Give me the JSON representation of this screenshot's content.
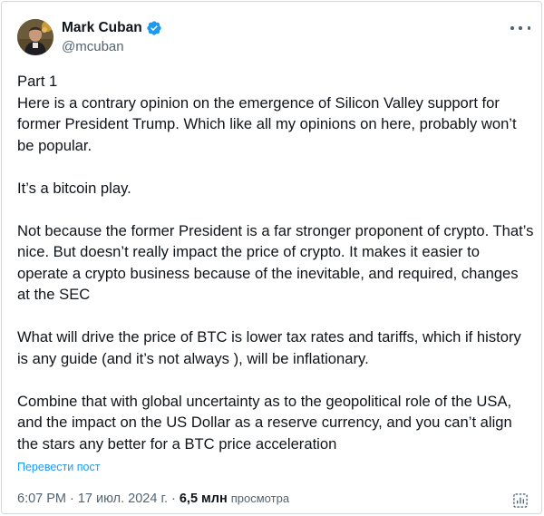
{
  "author": {
    "name": "Mark Cuban",
    "handle": "@mcuban",
    "avatar_icon": "portrait-photo",
    "verified_icon": "verified-badge-icon",
    "verified_color": "#1d9bf0"
  },
  "tweet": {
    "paragraphs": [
      "Part 1",
      "Here is a contrary opinion on the emergence of Silicon Valley support for former President Trump. Which like all my opinions on here, probably won’t be popular.",
      "It’s a bitcoin play.",
      "Not because the former President is a far stronger proponent of crypto. That’s nice. But doesn’t really impact the price of crypto. It makes it easier to operate a crypto business because of the inevitable, and required, changes at the SEC",
      "What will drive the price of BTC is lower tax rates and tariffs, which if history is any guide (and it’s not always ), will be inflationary.",
      "Combine that with global uncertainty as to the geopolitical role of the USA, and the impact on the US Dollar as a reserve currency, and you can’t align the stars any better for a BTC price acceleration"
    ],
    "translate_label": "Перевести пост"
  },
  "meta": {
    "time": "6:07 PM",
    "separator": "·",
    "date": "17 июл. 2024 г.",
    "views_count": "6,5 млн",
    "views_label": "просмотра"
  },
  "colors": {
    "text": "#0f1419",
    "secondary": "#536471",
    "link": "#1d9bf0",
    "border": "#cfd9de"
  }
}
